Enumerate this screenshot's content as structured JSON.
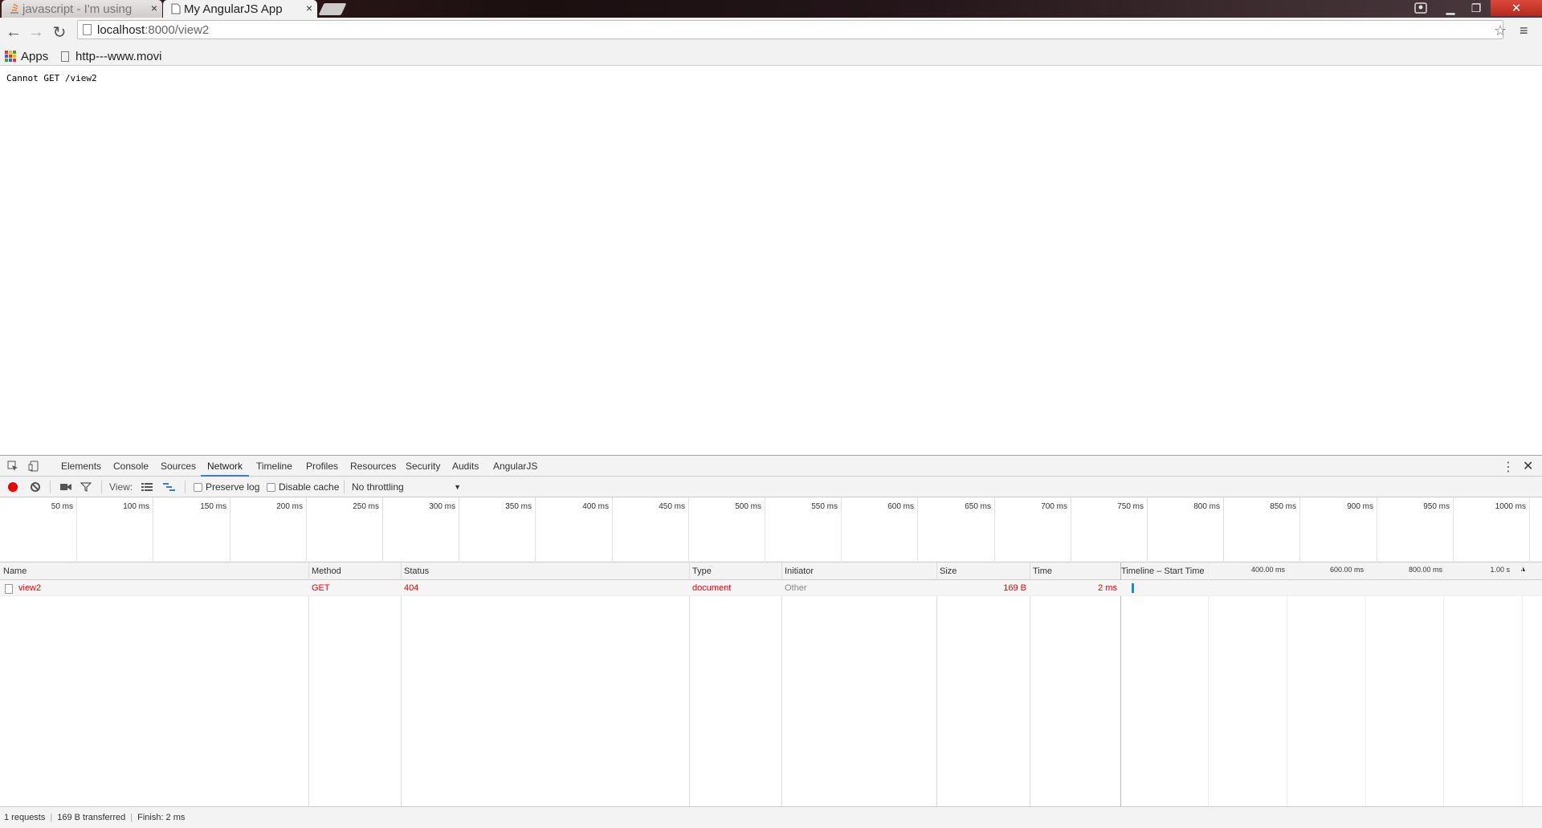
{
  "browser": {
    "tabs": [
      {
        "title": "javascript - I'm using",
        "close": "×"
      },
      {
        "title": "My AngularJS App",
        "close": "×"
      }
    ],
    "window_controls": {
      "minimize": "▁",
      "maximize": "❐",
      "close": "✕"
    },
    "nav": {
      "back": "←",
      "forward": "→",
      "reload": "↻"
    },
    "address": {
      "host": "localhost",
      "path": ":8000/view2"
    },
    "star": "☆",
    "menu": "≡",
    "bookmarks": [
      {
        "label": "Apps"
      },
      {
        "label": "http---www.movi"
      }
    ]
  },
  "page": {
    "text": "Cannot GET /view2"
  },
  "devtools": {
    "tabs": [
      "Elements",
      "Console",
      "Sources",
      "Network",
      "Timeline",
      "Profiles",
      "Resources",
      "Security",
      "Audits",
      "AngularJS"
    ],
    "active_tab": "Network",
    "more": "⋮",
    "close": "✕",
    "toolbar": {
      "view_label": "View:",
      "preserve_log": "Preserve log",
      "disable_cache": "Disable cache",
      "throttling": "No throttling",
      "dropdown_arrow": "▼"
    },
    "overview_ticks": [
      "50 ms",
      "100 ms",
      "150 ms",
      "200 ms",
      "250 ms",
      "300 ms",
      "350 ms",
      "400 ms",
      "450 ms",
      "500 ms",
      "550 ms",
      "600 ms",
      "650 ms",
      "700 ms",
      "750 ms",
      "800 ms",
      "850 ms",
      "900 ms",
      "950 ms",
      "1000 ms"
    ],
    "columns": [
      "Name",
      "Method",
      "Status",
      "Type",
      "Initiator",
      "Size",
      "Time",
      "Timeline – Start Time"
    ],
    "waterfall_ticks": [
      "400.00 ms",
      "600.00 ms",
      "800.00 ms",
      "1.00 s"
    ],
    "sort_arrow": "▲",
    "requests": [
      {
        "name": "view2",
        "method": "GET",
        "status": "404",
        "type": "document",
        "initiator": "Other",
        "size": "169 B",
        "time": "2 ms"
      }
    ],
    "status": {
      "requests": "1 requests",
      "transferred": "169 B transferred",
      "finish": "Finish: 2 ms",
      "divider": "|"
    }
  },
  "colors": {
    "error": "#ee0000",
    "accent": "#3879d9",
    "record": "#ee0000",
    "waterfall_bar": "#1a8ae3"
  }
}
